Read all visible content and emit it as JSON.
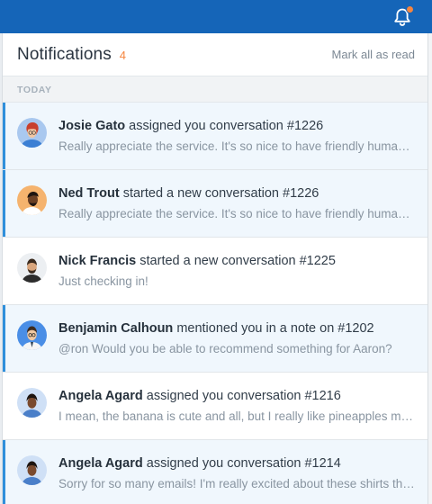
{
  "header": {
    "title": "Notifications",
    "count": "4",
    "mark_all_label": "Mark all as read"
  },
  "section": {
    "label": "TODAY"
  },
  "colors": {
    "topbar": "#1565b8",
    "accent_orange": "#f5853f",
    "unread_bar": "#2f8fdb",
    "unread_bg": "#f0f7fd"
  },
  "icons": {
    "bell": "bell-icon"
  },
  "notifications": [
    {
      "name": "Josie Gato",
      "action": " assigned you conversation #1226",
      "preview": "Really appreciate the service. It's so nice to have friendly human support for once.",
      "unread": true
    },
    {
      "name": "Ned Trout",
      "action": " started a new conversation #1226",
      "preview": "Really appreciate the service. It's so nice to have friendly human support for once.",
      "unread": true
    },
    {
      "name": "Nick Francis",
      "action": " started a new conversation #1225",
      "preview": "Just checking in!",
      "unread": false
    },
    {
      "name": "Benjamin Calhoun",
      "action": " mentioned you in a note on #1202",
      "preview": "@ron Would you be able to recommend something for Aaron?",
      "unread": true
    },
    {
      "name": "Angela Agard",
      "action": " assigned you conversation #1216",
      "preview": "I mean, the banana is cute and all, but I really like pineapples more.",
      "unread": false
    },
    {
      "name": "Angela Agard",
      "action": " assigned you conversation #1214",
      "preview": "Sorry for so many emails! I'm really excited about these shirts though.",
      "unread": true
    }
  ]
}
